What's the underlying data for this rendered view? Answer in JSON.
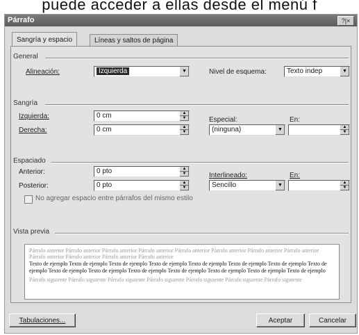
{
  "caption": "puede acceder a ellas desde el menú f",
  "dialog": {
    "title": "Párrafo",
    "title_buttons": "?|×",
    "tabs": [
      "Sangría y espacio",
      "Líneas y saltos de página"
    ]
  },
  "general": {
    "heading": "General",
    "alignment_label": "Alineación:",
    "alignment_value": "Izquierda",
    "outline_label": "Nivel de esquema:",
    "outline_value": "Texto indep"
  },
  "indent": {
    "heading": "Sangría",
    "left_label": "Izquierda:",
    "left_value": "0 cm",
    "right_label": "Derecha:",
    "right_value": "0 cm",
    "special_label": "Especial:",
    "special_value": "(ninguna)",
    "by_label": "En:",
    "by_value": ""
  },
  "spacing": {
    "heading": "Espaciado",
    "before_label": "Anterior:",
    "before_value": "0 pto",
    "after_label": "Posterior:",
    "after_value": "0 pto",
    "line_label": "Interlineado:",
    "line_value": "Sencillo",
    "at_label": "En:",
    "at_value": "",
    "no_space_same_style": "No agregar espacio entre párrafos del mismo estilo",
    "no_space_checked": false
  },
  "preview": {
    "heading": "Vista previa",
    "previous_text": "Párrafo anterior Párrafo anterior Párrafo anterior Párrafo anterior Párrafo anterior Párrafo anterior Párrafo anterior Párrafo anterior Párrafo anterior Párrafo anterior Párrafo anterior Párrafo anterior",
    "current_text": "Texto de ejemplo Texto de ejemplo Texto de ejemplo Texto de ejemplo Texto de ejemplo Texto de ejemplo Texto de ejemplo Texto de ejemplo Texto de ejemplo Texto de ejemplo Texto de ejemplo Texto de ejemplo Texto de ejemplo Texto de ejemplo Texto de ejemplo",
    "next_text": "Párrafo siguiente Párrafo siguiente Párrafo siguiente Párrafo siguiente Párrafo siguiente Párrafo siguiente Párrafo siguiente"
  },
  "buttons": {
    "tabs_button": "Tabulaciones...",
    "ok": "Aceptar",
    "cancel": "Cancelar"
  }
}
